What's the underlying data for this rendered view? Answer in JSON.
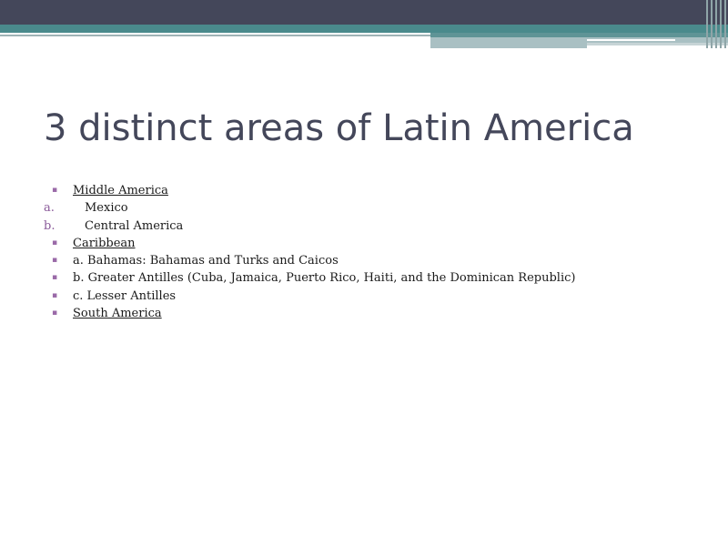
{
  "slide": {
    "title": "3 distinct areas of Latin America",
    "items": [
      {
        "kind": "bullet",
        "marker": "▪",
        "text": "Middle America",
        "underline": true
      },
      {
        "kind": "sub",
        "marker": "a.",
        "text": "Mexico",
        "underline": false
      },
      {
        "kind": "sub",
        "marker": "b.",
        "text": "Central America",
        "underline": false
      },
      {
        "kind": "bullet",
        "marker": "▪",
        "text": "Caribbean",
        "underline": true
      },
      {
        "kind": "bullet",
        "marker": "▪",
        "text": "a. Bahamas: Bahamas and Turks and Caicos",
        "underline": false
      },
      {
        "kind": "bullet",
        "marker": "▪",
        "text": "b. Greater Antilles (Cuba, Jamaica, Puerto Rico, Haiti, and the Dominican Republic)",
        "underline": false
      },
      {
        "kind": "bullet",
        "marker": "▪",
        "text": "c. Lesser Antilles",
        "underline": false
      },
      {
        "kind": "bullet",
        "marker": "▪",
        "text": "South America",
        "underline": true
      }
    ]
  },
  "theme": {
    "header_dark": "#44475a",
    "header_teal": "#4a8a8c",
    "title_color": "#44475a",
    "bullet_color": "#9a6aa8"
  }
}
